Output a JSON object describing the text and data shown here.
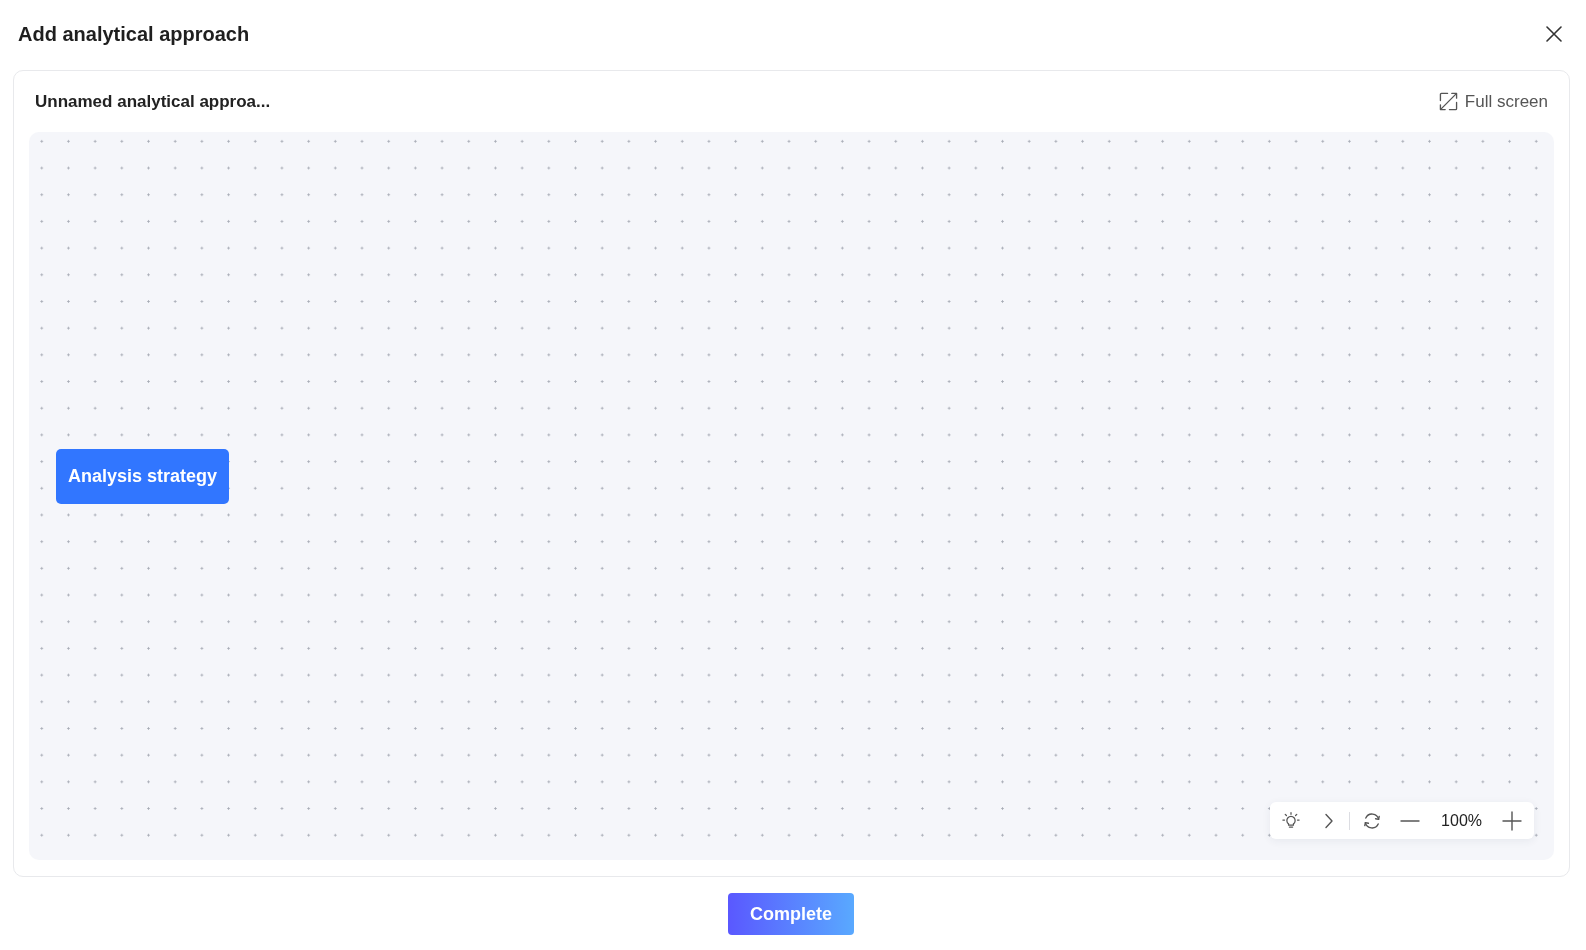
{
  "dialog": {
    "title": "Add analytical approach"
  },
  "panel": {
    "title": "Unnamed analytical approa...",
    "full_screen": "Full screen"
  },
  "canvas": {
    "nodes": [
      {
        "label": "Analysis strategy"
      }
    ]
  },
  "zoom_toolbar": {
    "zoom_level": "100%"
  },
  "footer": {
    "button": "Complete"
  }
}
